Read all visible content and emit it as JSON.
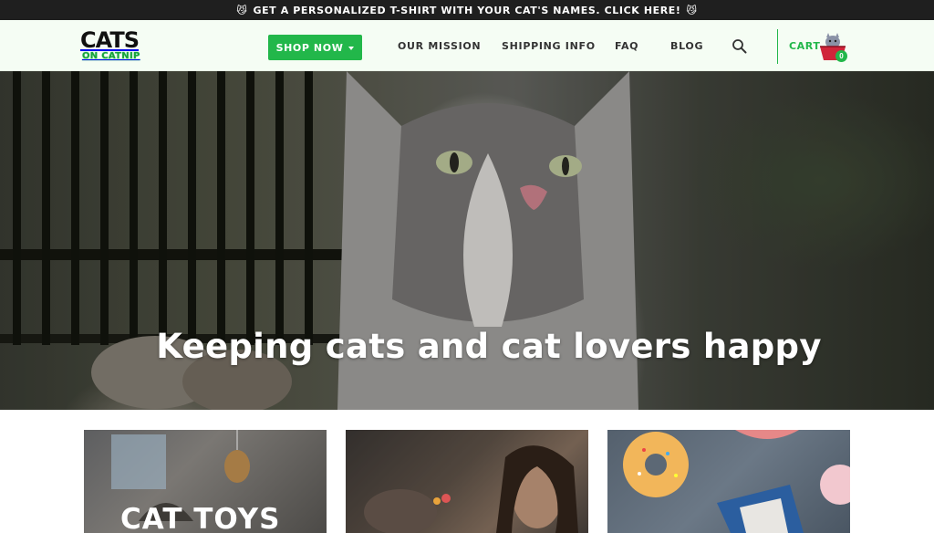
{
  "announcement": {
    "emoji": "😼",
    "text": "GET A PERSONALIZED T-SHIRT WITH YOUR CAT'S NAMES. CLICK HERE!"
  },
  "logo": {
    "top": "CATS",
    "bottom": "ON CATNIP"
  },
  "nav": {
    "shop_label": "SHOP NOW",
    "links": [
      "OUR MISSION",
      "SHIPPING INFO",
      "FAQ",
      "BLOG"
    ],
    "cart_label": "CART",
    "cart_count": "0"
  },
  "hero": {
    "title": "Keeping cats and cat lovers happy"
  },
  "cards": [
    {
      "title": "CAT TOYS"
    },
    {
      "title": ""
    },
    {
      "title": ""
    }
  ],
  "colors": {
    "accent": "#22b74a",
    "topbar": "#1f1f1f",
    "header_bg": "#f5fdf4"
  }
}
